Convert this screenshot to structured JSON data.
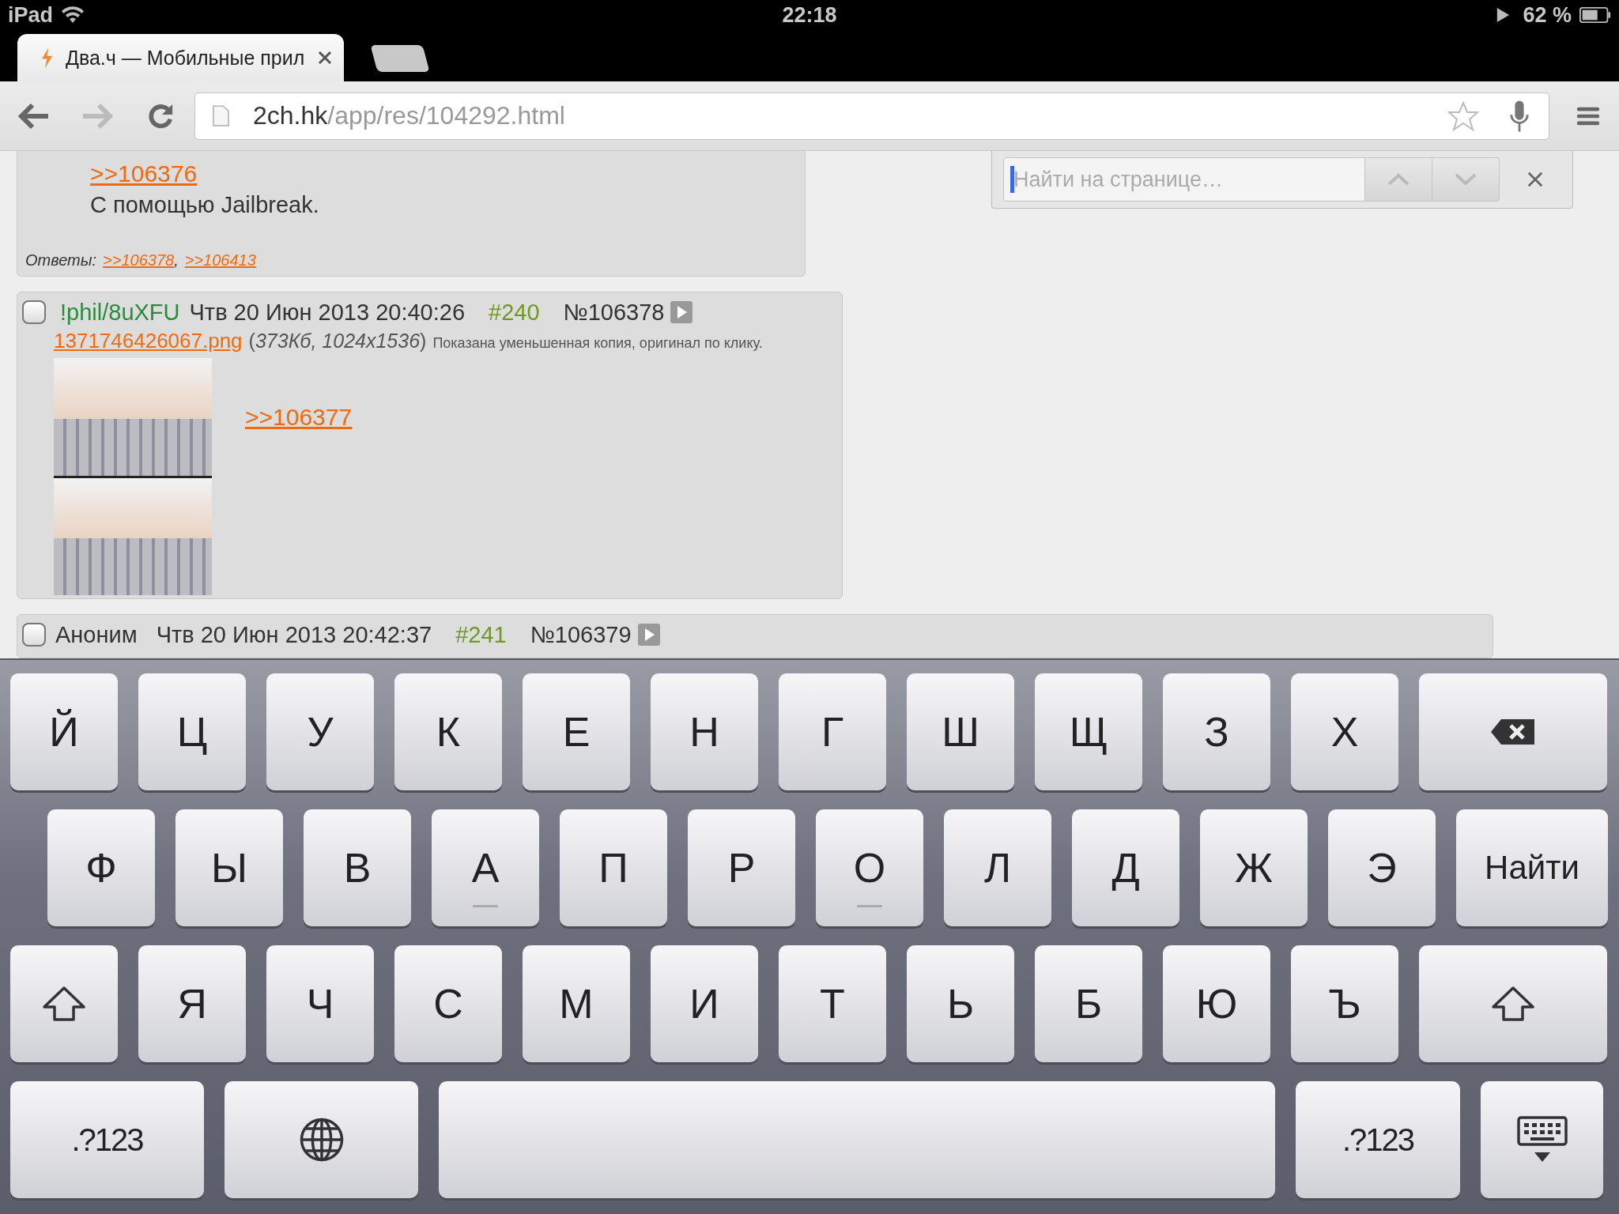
{
  "status_bar": {
    "device": "iPad",
    "time": "22:18",
    "battery": "62 %"
  },
  "tabs": [
    {
      "title": "Два.ч — Мобильные прил",
      "selected": true
    }
  ],
  "toolbar": {
    "url_host": "2ch.hk",
    "url_path": "/app/res/104292.html"
  },
  "find_bar": {
    "placeholder": "Найти на странице…"
  },
  "posts": [
    {
      "kind": "partial",
      "quote": ">>106376",
      "text": "С помощью Jailbreak.",
      "replies_label": "Ответы:",
      "replies": [
        ">>106378",
        ">>106413"
      ],
      "separator": ","
    },
    {
      "kind": "full",
      "checked": false,
      "author": {
        "name": "!phil/8uXFU",
        "color": "#2e8b3e"
      },
      "date": "Чтв 20 Июн 2013 20:40:26",
      "num": "#240",
      "id": "№106378",
      "file": {
        "name": "1371746426067.png",
        "info": "(*373Кб, 1024x1536*)",
        "note": "Показана уменьшенная копия, оригинал по клику."
      },
      "quote": ">>106377"
    },
    {
      "kind": "header",
      "checked": false,
      "author": {
        "name": "Аноним",
        "color": "#333333"
      },
      "date": "Чтв 20 Июн 2013 20:42:37",
      "num": "#241",
      "id": "№106379"
    }
  ],
  "keyboard": {
    "rows": [
      [
        {
          "kind": "letter",
          "label": "Й"
        },
        {
          "kind": "letter",
          "label": "Ц"
        },
        {
          "kind": "letter",
          "label": "У"
        },
        {
          "kind": "letter",
          "label": "К"
        },
        {
          "kind": "letter",
          "label": "Е"
        },
        {
          "kind": "letter",
          "label": "Н"
        },
        {
          "kind": "letter",
          "label": "Г"
        },
        {
          "kind": "letter",
          "label": "Ш"
        },
        {
          "kind": "letter",
          "label": "Щ"
        },
        {
          "kind": "letter",
          "label": "З"
        },
        {
          "kind": "letter",
          "label": "Х"
        },
        {
          "kind": "backspace"
        }
      ],
      [
        {
          "kind": "letter",
          "label": "Ф"
        },
        {
          "kind": "letter",
          "label": "Ы"
        },
        {
          "kind": "letter",
          "label": "В"
        },
        {
          "kind": "letter",
          "label": "А",
          "bump": true
        },
        {
          "kind": "letter",
          "label": "П"
        },
        {
          "kind": "letter",
          "label": "Р"
        },
        {
          "kind": "letter",
          "label": "О",
          "bump": true
        },
        {
          "kind": "letter",
          "label": "Л"
        },
        {
          "kind": "letter",
          "label": "Д"
        },
        {
          "kind": "letter",
          "label": "Ж"
        },
        {
          "kind": "letter",
          "label": "Э"
        },
        {
          "kind": "search",
          "label": "Найти"
        }
      ],
      [
        {
          "kind": "shift"
        },
        {
          "kind": "letter",
          "label": "Я"
        },
        {
          "kind": "letter",
          "label": "Ч"
        },
        {
          "kind": "letter",
          "label": "С"
        },
        {
          "kind": "letter",
          "label": "М"
        },
        {
          "kind": "letter",
          "label": "И"
        },
        {
          "kind": "letter",
          "label": "Т"
        },
        {
          "kind": "letter",
          "label": "Ь"
        },
        {
          "kind": "letter",
          "label": "Б"
        },
        {
          "kind": "letter",
          "label": "Ю"
        },
        {
          "kind": "letter",
          "label": "Ъ"
        },
        {
          "kind": "shift_wide"
        }
      ],
      [
        {
          "kind": "numbers",
          "label": ".?123"
        },
        {
          "kind": "globe"
        },
        {
          "kind": "space"
        },
        {
          "kind": "numbers_right",
          "label": ".?123"
        },
        {
          "kind": "hide"
        }
      ]
    ]
  }
}
